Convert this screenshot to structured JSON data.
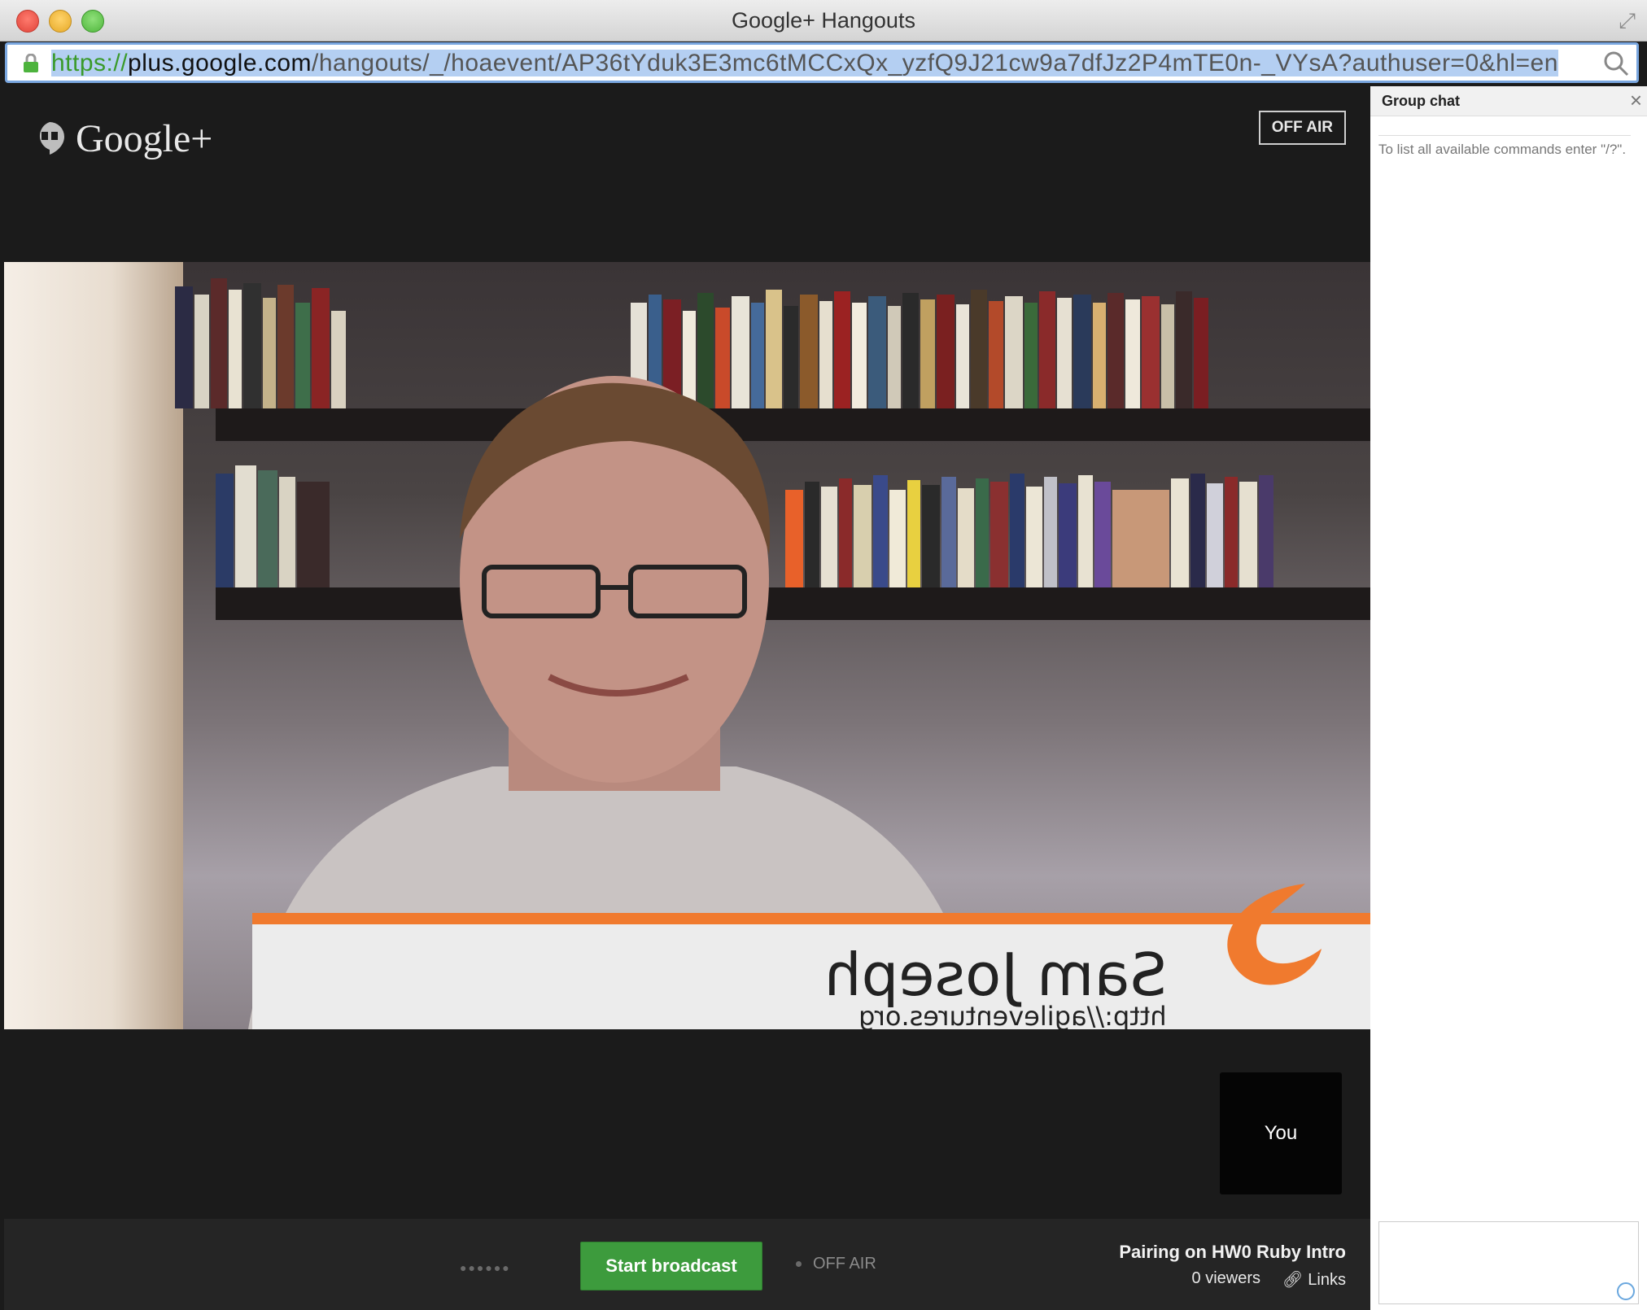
{
  "window": {
    "title": "Google+ Hangouts"
  },
  "address_bar": {
    "scheme": "https://",
    "host": "plus.google.com",
    "path": "/hangouts/_/hoaevent/AP36tYduk3E3mc6tMCCxQx_yzfQ9J21cw9a7dfJz2P4mTE0n-_VYsA?authuser=0&hl=en"
  },
  "header": {
    "logo_text": "Google+",
    "status_badge": "OFF AIR"
  },
  "video": {
    "lower_third_name": "Sam Joseph",
    "lower_third_url": "http://agileventures.org"
  },
  "self_tile": {
    "label": "You"
  },
  "toolbar": {
    "start_label": "Start broadcast",
    "status": "OFF AIR",
    "event_title": "Pairing on HW0 Ruby Intro",
    "viewers": "0 viewers",
    "links_label": "Links"
  },
  "chat": {
    "title": "Group chat",
    "help_text": "To list all available commands enter \"/?\"."
  },
  "colors": {
    "accent_green": "#3d9b3d",
    "lower_third_orange": "#f07a2e",
    "url_green": "#3a9a2a"
  }
}
